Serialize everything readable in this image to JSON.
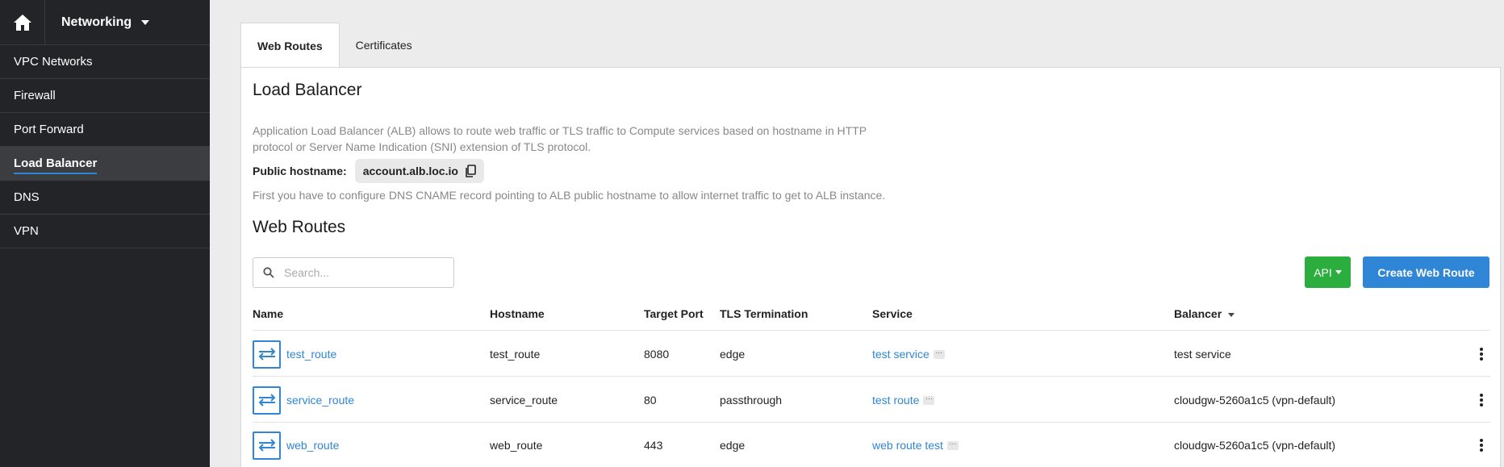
{
  "sidebar": {
    "section": "Networking",
    "items": [
      {
        "label": "VPC Networks"
      },
      {
        "label": "Firewall"
      },
      {
        "label": "Port Forward"
      },
      {
        "label": "Load Balancer"
      },
      {
        "label": "DNS"
      },
      {
        "label": "VPN"
      }
    ],
    "active_index": 3
  },
  "tabs": [
    {
      "label": "Web Routes"
    },
    {
      "label": "Certificates"
    }
  ],
  "main": {
    "title": "Load Balancer",
    "description": "Application Load Balancer (ALB) allows to route web traffic or TLS traffic to Compute services based on hostname in HTTP protocol or Server Name Indication (SNI) extension of TLS protocol.",
    "public_hostname_label": "Public hostname:",
    "public_hostname": "account.alb.loc.io",
    "hint": "First you have to configure DNS CNAME record pointing to ALB public hostname to allow internet traffic to get to ALB instance.",
    "section_title": "Web Routes",
    "search_placeholder": "Search...",
    "api_label": "API",
    "create_label": "Create Web Route"
  },
  "table": {
    "columns": [
      "Name",
      "Hostname",
      "Target Port",
      "TLS Termination",
      "Service",
      "Balancer"
    ],
    "rows": [
      {
        "name": "test_route",
        "hostname": "test_route",
        "port": "8080",
        "tls": "edge",
        "service": "test service",
        "balancer": "test service"
      },
      {
        "name": "service_route",
        "hostname": "service_route",
        "port": "80",
        "tls": "passthrough",
        "service": "test route",
        "balancer": "cloudgw-5260a1c5 (vpn-default)"
      },
      {
        "name": "web_route",
        "hostname": "web_route",
        "port": "443",
        "tls": "edge",
        "service": "web route test",
        "balancer": "cloudgw-5260a1c5 (vpn-default)"
      }
    ],
    "more_chip": "···"
  },
  "colors": {
    "sidebar_bg": "#222427",
    "accent": "#2f86d6",
    "api_green": "#2cae3f"
  }
}
